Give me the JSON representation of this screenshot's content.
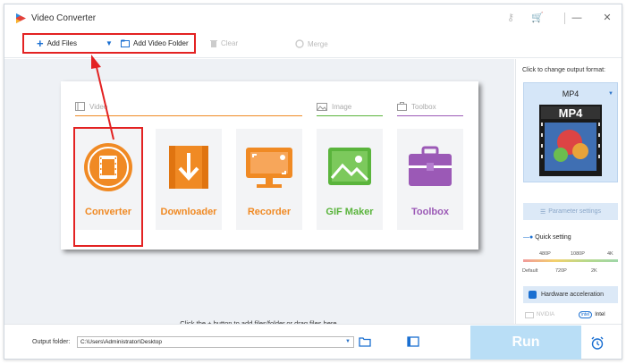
{
  "window": {
    "title": "Video Converter"
  },
  "toolbar": {
    "add_files": "Add Files",
    "add_video_folder": "Add Video Folder",
    "clear": "Clear",
    "merge": "Merge"
  },
  "sections": {
    "video": "Video",
    "image": "Image",
    "toolbox": "Toolbox"
  },
  "tiles": [
    {
      "label": "Converter",
      "color": "#f08a24",
      "icon": "film-convert-icon"
    },
    {
      "label": "Downloader",
      "color": "#f08a24",
      "icon": "download-icon"
    },
    {
      "label": "Recorder",
      "color": "#f08a24",
      "icon": "screen-record-icon"
    },
    {
      "label": "GIF Maker",
      "color": "#5ab43c",
      "icon": "image-icon"
    },
    {
      "label": "Toolbox",
      "color": "#9b59b6",
      "icon": "toolbox-icon"
    }
  ],
  "hint": "Click the + button to add files/folder,or drag files here.",
  "side": {
    "caption": "Click to change output format:",
    "format": "MP4",
    "format_thumbnail_text": "MP4",
    "parameter_settings": "Parameter settings",
    "quick_setting": "Quick setting",
    "quality_top": [
      "480P",
      "1080P",
      "4K"
    ],
    "quality_bottom": [
      "Default",
      "720P",
      "2K"
    ],
    "hardware_acceleration": "Hardware acceleration",
    "nvidia": "NVIDIA",
    "intel_logo": "intel",
    "intel": "Intel"
  },
  "bottom": {
    "output_label": "Output folder:",
    "output_path": "C:\\Users\\Administrator\\Desktop",
    "run": "Run"
  },
  "colors": {
    "accent": "#1a6fd1",
    "annotation_red": "#e32222",
    "run_button": "#b9def6",
    "orange": "#f08a24",
    "green": "#5ab43c",
    "purple": "#9b59b6"
  }
}
